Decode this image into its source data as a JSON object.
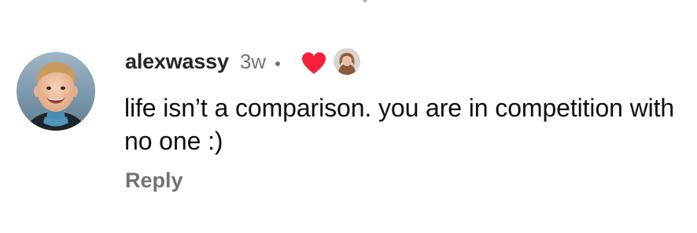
{
  "comment": {
    "username": "alexwassy",
    "timestamp": "3w",
    "text": "life isn’t a comparison. you are in competition with no one :)",
    "reply_label": "Reply",
    "liked_by_creator": true
  },
  "colors": {
    "heart": "#f5203b",
    "muted_text": "#737373",
    "username": "#262626"
  },
  "icons": {
    "heart": "heart-icon",
    "avatar": "user-avatar",
    "creator_avatar": "creator-avatar"
  }
}
